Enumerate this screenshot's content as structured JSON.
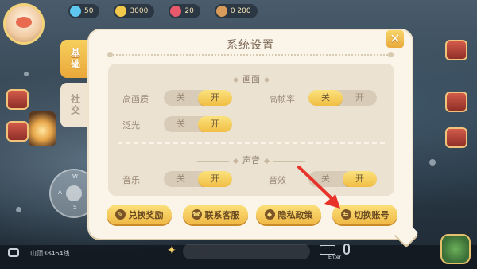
{
  "hud": {
    "resources": [
      {
        "icon": "gem-icon",
        "value": "50",
        "color": "#5ec7f0"
      },
      {
        "icon": "coin-icon",
        "value": "3000",
        "color": "#f2c94c"
      },
      {
        "icon": "heart-icon",
        "value": "20",
        "color": "#e85a6b"
      },
      {
        "icon": "bear-icon",
        "value": "0 200",
        "color": "#d99b5a"
      }
    ],
    "location": "山顶38464线",
    "enter_label": "Enter"
  },
  "settings": {
    "title": "系统设置",
    "close_glyph": "✕",
    "tabs": [
      {
        "label": "基础",
        "active": true
      },
      {
        "label": "社交",
        "active": false
      }
    ],
    "sections": {
      "graphics": {
        "heading": "画面",
        "options": [
          {
            "label": "高画质",
            "off": "关",
            "on": "开",
            "value": "on"
          },
          {
            "label": "高帧率",
            "off": "关",
            "on": "开",
            "value": "off"
          },
          {
            "label": "泛光",
            "off": "关",
            "on": "开",
            "value": "on"
          }
        ]
      },
      "sound": {
        "heading": "声音",
        "options": [
          {
            "label": "音乐",
            "off": "关",
            "on": "开",
            "value": "on"
          },
          {
            "label": "音效",
            "off": "关",
            "on": "开",
            "value": "on"
          }
        ]
      }
    },
    "actions": [
      {
        "label": "兑换奖励",
        "icon": "pencil-icon"
      },
      {
        "label": "联系客服",
        "icon": "headset-icon"
      },
      {
        "label": "隐私政策",
        "icon": "shield-icon"
      },
      {
        "label": "切换账号",
        "icon": "switch-arrows-icon"
      }
    ]
  },
  "colors": {
    "accent_yellow": "#f1be44",
    "panel_bg": "#fbf4e8",
    "annotation_red": "#e8332a"
  }
}
